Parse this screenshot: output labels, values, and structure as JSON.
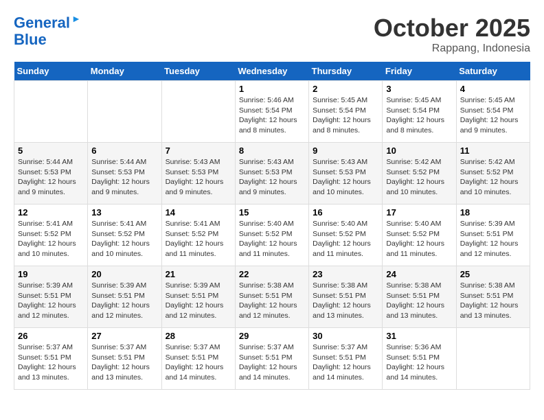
{
  "logo": {
    "line1": "General",
    "line2": "Blue"
  },
  "title": "October 2025",
  "location": "Rappang, Indonesia",
  "days_of_week": [
    "Sunday",
    "Monday",
    "Tuesday",
    "Wednesday",
    "Thursday",
    "Friday",
    "Saturday"
  ],
  "weeks": [
    [
      {
        "day": "",
        "sunrise": "",
        "sunset": "",
        "daylight": ""
      },
      {
        "day": "",
        "sunrise": "",
        "sunset": "",
        "daylight": ""
      },
      {
        "day": "",
        "sunrise": "",
        "sunset": "",
        "daylight": ""
      },
      {
        "day": "1",
        "sunrise": "Sunrise: 5:46 AM",
        "sunset": "Sunset: 5:54 PM",
        "daylight": "Daylight: 12 hours and 8 minutes."
      },
      {
        "day": "2",
        "sunrise": "Sunrise: 5:45 AM",
        "sunset": "Sunset: 5:54 PM",
        "daylight": "Daylight: 12 hours and 8 minutes."
      },
      {
        "day": "3",
        "sunrise": "Sunrise: 5:45 AM",
        "sunset": "Sunset: 5:54 PM",
        "daylight": "Daylight: 12 hours and 8 minutes."
      },
      {
        "day": "4",
        "sunrise": "Sunrise: 5:45 AM",
        "sunset": "Sunset: 5:54 PM",
        "daylight": "Daylight: 12 hours and 9 minutes."
      }
    ],
    [
      {
        "day": "5",
        "sunrise": "Sunrise: 5:44 AM",
        "sunset": "Sunset: 5:53 PM",
        "daylight": "Daylight: 12 hours and 9 minutes."
      },
      {
        "day": "6",
        "sunrise": "Sunrise: 5:44 AM",
        "sunset": "Sunset: 5:53 PM",
        "daylight": "Daylight: 12 hours and 9 minutes."
      },
      {
        "day": "7",
        "sunrise": "Sunrise: 5:43 AM",
        "sunset": "Sunset: 5:53 PM",
        "daylight": "Daylight: 12 hours and 9 minutes."
      },
      {
        "day": "8",
        "sunrise": "Sunrise: 5:43 AM",
        "sunset": "Sunset: 5:53 PM",
        "daylight": "Daylight: 12 hours and 9 minutes."
      },
      {
        "day": "9",
        "sunrise": "Sunrise: 5:43 AM",
        "sunset": "Sunset: 5:53 PM",
        "daylight": "Daylight: 12 hours and 10 minutes."
      },
      {
        "day": "10",
        "sunrise": "Sunrise: 5:42 AM",
        "sunset": "Sunset: 5:52 PM",
        "daylight": "Daylight: 12 hours and 10 minutes."
      },
      {
        "day": "11",
        "sunrise": "Sunrise: 5:42 AM",
        "sunset": "Sunset: 5:52 PM",
        "daylight": "Daylight: 12 hours and 10 minutes."
      }
    ],
    [
      {
        "day": "12",
        "sunrise": "Sunrise: 5:41 AM",
        "sunset": "Sunset: 5:52 PM",
        "daylight": "Daylight: 12 hours and 10 minutes."
      },
      {
        "day": "13",
        "sunrise": "Sunrise: 5:41 AM",
        "sunset": "Sunset: 5:52 PM",
        "daylight": "Daylight: 12 hours and 10 minutes."
      },
      {
        "day": "14",
        "sunrise": "Sunrise: 5:41 AM",
        "sunset": "Sunset: 5:52 PM",
        "daylight": "Daylight: 12 hours and 11 minutes."
      },
      {
        "day": "15",
        "sunrise": "Sunrise: 5:40 AM",
        "sunset": "Sunset: 5:52 PM",
        "daylight": "Daylight: 12 hours and 11 minutes."
      },
      {
        "day": "16",
        "sunrise": "Sunrise: 5:40 AM",
        "sunset": "Sunset: 5:52 PM",
        "daylight": "Daylight: 12 hours and 11 minutes."
      },
      {
        "day": "17",
        "sunrise": "Sunrise: 5:40 AM",
        "sunset": "Sunset: 5:52 PM",
        "daylight": "Daylight: 12 hours and 11 minutes."
      },
      {
        "day": "18",
        "sunrise": "Sunrise: 5:39 AM",
        "sunset": "Sunset: 5:51 PM",
        "daylight": "Daylight: 12 hours and 12 minutes."
      }
    ],
    [
      {
        "day": "19",
        "sunrise": "Sunrise: 5:39 AM",
        "sunset": "Sunset: 5:51 PM",
        "daylight": "Daylight: 12 hours and 12 minutes."
      },
      {
        "day": "20",
        "sunrise": "Sunrise: 5:39 AM",
        "sunset": "Sunset: 5:51 PM",
        "daylight": "Daylight: 12 hours and 12 minutes."
      },
      {
        "day": "21",
        "sunrise": "Sunrise: 5:39 AM",
        "sunset": "Sunset: 5:51 PM",
        "daylight": "Daylight: 12 hours and 12 minutes."
      },
      {
        "day": "22",
        "sunrise": "Sunrise: 5:38 AM",
        "sunset": "Sunset: 5:51 PM",
        "daylight": "Daylight: 12 hours and 12 minutes."
      },
      {
        "day": "23",
        "sunrise": "Sunrise: 5:38 AM",
        "sunset": "Sunset: 5:51 PM",
        "daylight": "Daylight: 12 hours and 13 minutes."
      },
      {
        "day": "24",
        "sunrise": "Sunrise: 5:38 AM",
        "sunset": "Sunset: 5:51 PM",
        "daylight": "Daylight: 12 hours and 13 minutes."
      },
      {
        "day": "25",
        "sunrise": "Sunrise: 5:38 AM",
        "sunset": "Sunset: 5:51 PM",
        "daylight": "Daylight: 12 hours and 13 minutes."
      }
    ],
    [
      {
        "day": "26",
        "sunrise": "Sunrise: 5:37 AM",
        "sunset": "Sunset: 5:51 PM",
        "daylight": "Daylight: 12 hours and 13 minutes."
      },
      {
        "day": "27",
        "sunrise": "Sunrise: 5:37 AM",
        "sunset": "Sunset: 5:51 PM",
        "daylight": "Daylight: 12 hours and 13 minutes."
      },
      {
        "day": "28",
        "sunrise": "Sunrise: 5:37 AM",
        "sunset": "Sunset: 5:51 PM",
        "daylight": "Daylight: 12 hours and 14 minutes."
      },
      {
        "day": "29",
        "sunrise": "Sunrise: 5:37 AM",
        "sunset": "Sunset: 5:51 PM",
        "daylight": "Daylight: 12 hours and 14 minutes."
      },
      {
        "day": "30",
        "sunrise": "Sunrise: 5:37 AM",
        "sunset": "Sunset: 5:51 PM",
        "daylight": "Daylight: 12 hours and 14 minutes."
      },
      {
        "day": "31",
        "sunrise": "Sunrise: 5:36 AM",
        "sunset": "Sunset: 5:51 PM",
        "daylight": "Daylight: 12 hours and 14 minutes."
      },
      {
        "day": "",
        "sunrise": "",
        "sunset": "",
        "daylight": ""
      }
    ]
  ]
}
